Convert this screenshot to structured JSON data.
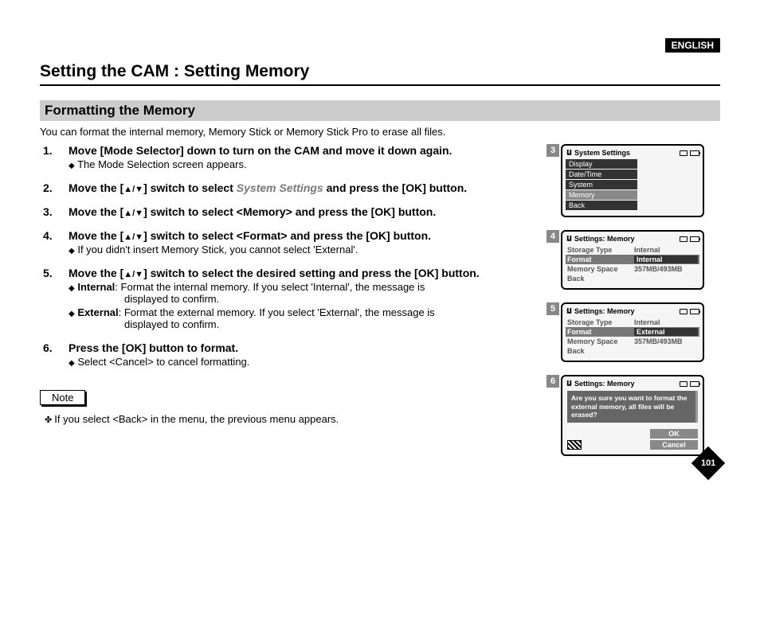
{
  "lang_badge": "ENGLISH",
  "title": "Setting the CAM : Setting Memory",
  "subtitle": "Formatting the Memory",
  "intro": "You can format the internal memory, Memory Stick or Memory Stick Pro to erase all files.",
  "steps": {
    "s1": {
      "main_a": "Move [Mode Selector] down to turn on the CAM and move it down again.",
      "b1": "The Mode Selection screen appears."
    },
    "s2": {
      "pre": "Move the [",
      "mid": "] switch to select ",
      "sys": "System Settings",
      "post": " and press the [OK] button."
    },
    "s3": {
      "pre": "Move the [",
      "post": "] switch to select <Memory> and press the [OK] button."
    },
    "s4": {
      "pre": "Move the [",
      "post": "] switch to select <Format> and press the [OK] button.",
      "b1": "If you didn't insert Memory Stick, you cannot select 'External'."
    },
    "s5": {
      "pre": "Move the [",
      "post": "] switch to select the desired setting and press the [OK] button.",
      "b1_label": "Internal",
      "b1_text": ": Format the internal memory. If you select  'Internal', the message is",
      "b1_cont": "displayed to confirm.",
      "b2_label": "External",
      "b2_text": ": Format the external memory. If you select 'External', the message is",
      "b2_cont": "displayed to confirm."
    },
    "s6": {
      "main": "Press the [OK] button to format.",
      "b1": "Select <Cancel> to cancel formatting."
    }
  },
  "note_label": "Note",
  "note_text": "If you select <Back> in the menu, the previous menu appears.",
  "screens": {
    "s3": {
      "num": "3",
      "title": "System Settings",
      "items": [
        "Display",
        "Date/Time",
        "System",
        "Memory",
        "Back"
      ],
      "selected": "Memory"
    },
    "s4": {
      "num": "4",
      "title": "Settings: Memory",
      "rows": [
        {
          "k": "Storage Type",
          "v": "Internal",
          "sel": false
        },
        {
          "k": "Format",
          "v": "Internal",
          "sel": true
        },
        {
          "k": "Memory Space",
          "v": "357MB/493MB",
          "sel": false
        },
        {
          "k": "Back",
          "v": "",
          "sel": false
        }
      ]
    },
    "s5": {
      "num": "5",
      "title": "Settings: Memory",
      "rows": [
        {
          "k": "Storage Type",
          "v": "Internal",
          "sel": false
        },
        {
          "k": "Format",
          "v": "External",
          "sel": true
        },
        {
          "k": "Memory Space",
          "v": "357MB/493MB",
          "sel": false
        },
        {
          "k": "Back",
          "v": "",
          "sel": false
        }
      ]
    },
    "s6": {
      "num": "6",
      "title": "Settings: Memory",
      "dialog": "Are you sure you want to format the external memory, all files will be erased?",
      "ok": "OK",
      "cancel": "Cancel"
    }
  },
  "page_number": "101"
}
